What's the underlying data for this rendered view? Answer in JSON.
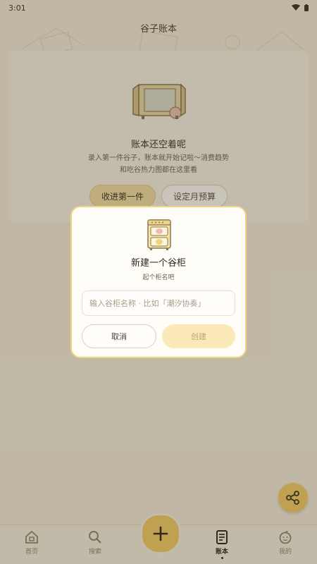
{
  "status": {
    "time": "3:01"
  },
  "header": {
    "title": "谷子账本"
  },
  "empty_state": {
    "title": "账本还空着呢",
    "desc_line1": "录入第一件谷子，账本就开始记啦～消费趋势",
    "desc_line2": "和吃谷热力图都在这里看",
    "primary_label": "收进第一件",
    "secondary_label": "设定月预算"
  },
  "dialog": {
    "title": "新建一个谷柜",
    "subtitle": "起个柜名吧",
    "input_placeholder": "输入谷柜名称 · 比如「潮汐协奏」",
    "input_value": "",
    "cancel_label": "取消",
    "create_label": "创建"
  },
  "nav": {
    "items": [
      {
        "label": "首页",
        "icon": "home-icon"
      },
      {
        "label": "搜索",
        "icon": "search-icon"
      },
      {
        "label": "账本",
        "icon": "ledger-icon",
        "active": true
      },
      {
        "label": "我的",
        "icon": "profile-icon"
      }
    ],
    "add_icon": "plus-icon"
  },
  "colors": {
    "accent": "#f1cc66",
    "background": "#f3ecd9",
    "dialog_border": "#f0d480"
  }
}
